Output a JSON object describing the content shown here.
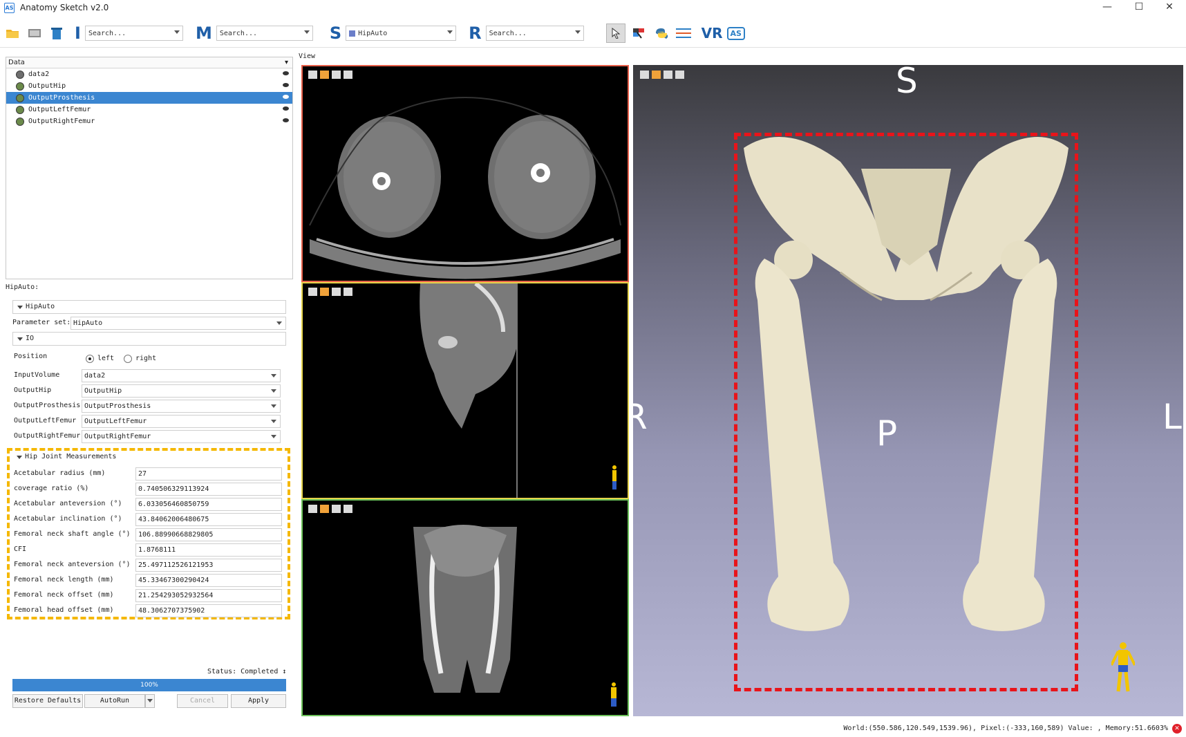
{
  "window": {
    "logo_text": "AS",
    "title": "Anatomy Sketch v2.0",
    "minimize": "—",
    "maximize": "☐",
    "close": "✕"
  },
  "toolbar": {
    "letters": {
      "i": "I",
      "m": "M",
      "s": "S",
      "r": "R",
      "vr": "VR",
      "as": "AS"
    },
    "search_i": "Search...",
    "search_m": "Search...",
    "module_s": "HipAuto",
    "search_r": "Search..."
  },
  "data_panel": {
    "header": "Data",
    "header_menu": "▾",
    "items": [
      {
        "label": "data2",
        "selected": false,
        "color": "#6e6e6e"
      },
      {
        "label": "OutputHip",
        "selected": false,
        "color": "#6b8a4a"
      },
      {
        "label": "OutputProsthesis",
        "selected": true,
        "color": "#6b8a4a"
      },
      {
        "label": "OutputLeftFemur",
        "selected": false,
        "color": "#6b8a4a"
      },
      {
        "label": "OutputRightFemur",
        "selected": false,
        "color": "#6b8a4a"
      }
    ]
  },
  "module": {
    "label": "HipAuto:",
    "section_main": "HipAuto",
    "param_label": "Parameter set:",
    "param_value": "HipAuto",
    "section_io": "IO",
    "position_label": "Position",
    "position_left": "left",
    "position_right": "right",
    "io": [
      {
        "label": "InputVolume",
        "value": "data2"
      },
      {
        "label": "OutputHip",
        "value": "OutputHip"
      },
      {
        "label": "OutputProsthesis",
        "value": "OutputProsthesis"
      },
      {
        "label": "OutputLeftFemur",
        "value": "OutputLeftFemur"
      },
      {
        "label": "OutputRightFemur",
        "value": "OutputRightFemur"
      }
    ],
    "section_measure": "Hip Joint Measurements",
    "measurements": [
      {
        "label": "Acetabular radius (mm)",
        "value": "27"
      },
      {
        "label": "coverage ratio (%)",
        "value": "0.740506329113924"
      },
      {
        "label": "Acetabular anteversion (°)",
        "value": "6.033056460850759"
      },
      {
        "label": "Acetabular inclination (°)",
        "value": "43.84062006480675"
      },
      {
        "label": "Femoral neck shaft angle (°)",
        "value": "106.88990668829805"
      },
      {
        "label": "CFI",
        "value": "1.8768111"
      },
      {
        "label": "Femoral neck anteversion (°)",
        "value": "25.497112526121953"
      },
      {
        "label": "Femoral neck length (mm)",
        "value": "45.33467300290424"
      },
      {
        "label": "Femoral neck offset (mm)",
        "value": "21.254293052932564"
      },
      {
        "label": "Femoral head offset (mm)",
        "value": "48.3062707375902"
      }
    ],
    "status": "Status: Completed ↕",
    "progress_pct": 100,
    "progress_label": "100%",
    "buttons": {
      "restore": "Restore Defaults",
      "autorun": "AutoRun",
      "cancel": "Cancel",
      "apply": "Apply"
    }
  },
  "views": {
    "label": "View",
    "axial_border": "#e8604a",
    "sagittal_border": "#e6d44a",
    "coronal_border": "#6cc25a",
    "orientation": {
      "superior": "S",
      "right": "R",
      "posterior": "P",
      "left": "L"
    },
    "roi_color": "#e8141a"
  },
  "statusbar": {
    "text": "World:(550.586,120.549,1539.96), Pixel:(-333,160,589) Value: ,   Memory:51.6603%"
  }
}
